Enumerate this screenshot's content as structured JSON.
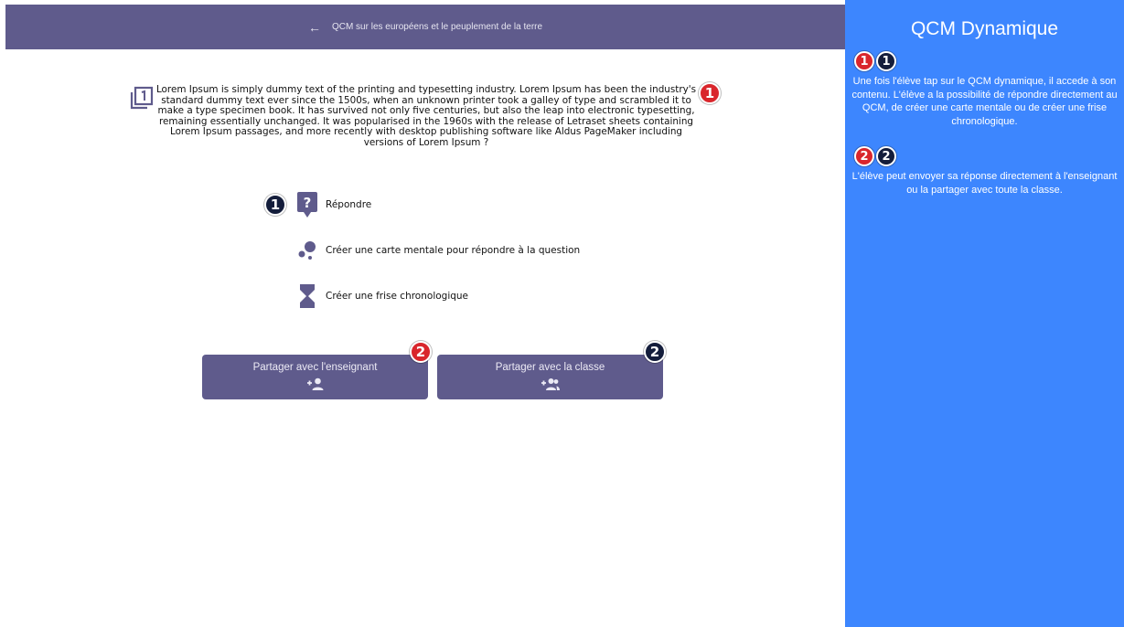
{
  "header": {
    "title": "QCM sur les européens  et le peuplement de la terre",
    "back_glyph": "←"
  },
  "question": {
    "icon": "filter-1-icon",
    "text": "Lorem Ipsum is simply dummy text of the printing and typesetting industry. Lorem Ipsum has been the industry's standard dummy text ever since the 1500s, when an unknown printer took a galley of type and scrambled it to make a type specimen book. It has survived not only five centuries, but also the leap into electronic typesetting, remaining essentially unchanged. It was popularised in the 1960s with the release of Letraset sheets containing Lorem Ipsum passages, and more recently with desktop publishing software like Aldus PageMaker including versions of Lorem Ipsum ?"
  },
  "options": {
    "answer": "Répondre",
    "mindmap": "Créer une carte mentale pour répondre à la question",
    "timeline": "Créer une frise chronologique"
  },
  "buttons": {
    "share_teacher": "Partager avec l'enseignant",
    "share_class": "Partager avec la classe"
  },
  "badges": {
    "one": "1",
    "two": "2"
  },
  "sidebar": {
    "title": "QCM Dynamique",
    "step1": "Une fois l'élève tap sur le QCM dynamique, il accede à son contenu. L'élève a la possibilité de répondre directement au QCM, de créer une carte mentale ou de créer une frise chronologique.",
    "step2": "L'élève peut envoyer sa réponse directement à l'enseignant ou la partager avec toute la classe."
  },
  "colors": {
    "header": "#5f5b8c",
    "sidebar": "#3d86fe",
    "badge_red": "#d9262c",
    "badge_navy": "#141d3b"
  }
}
